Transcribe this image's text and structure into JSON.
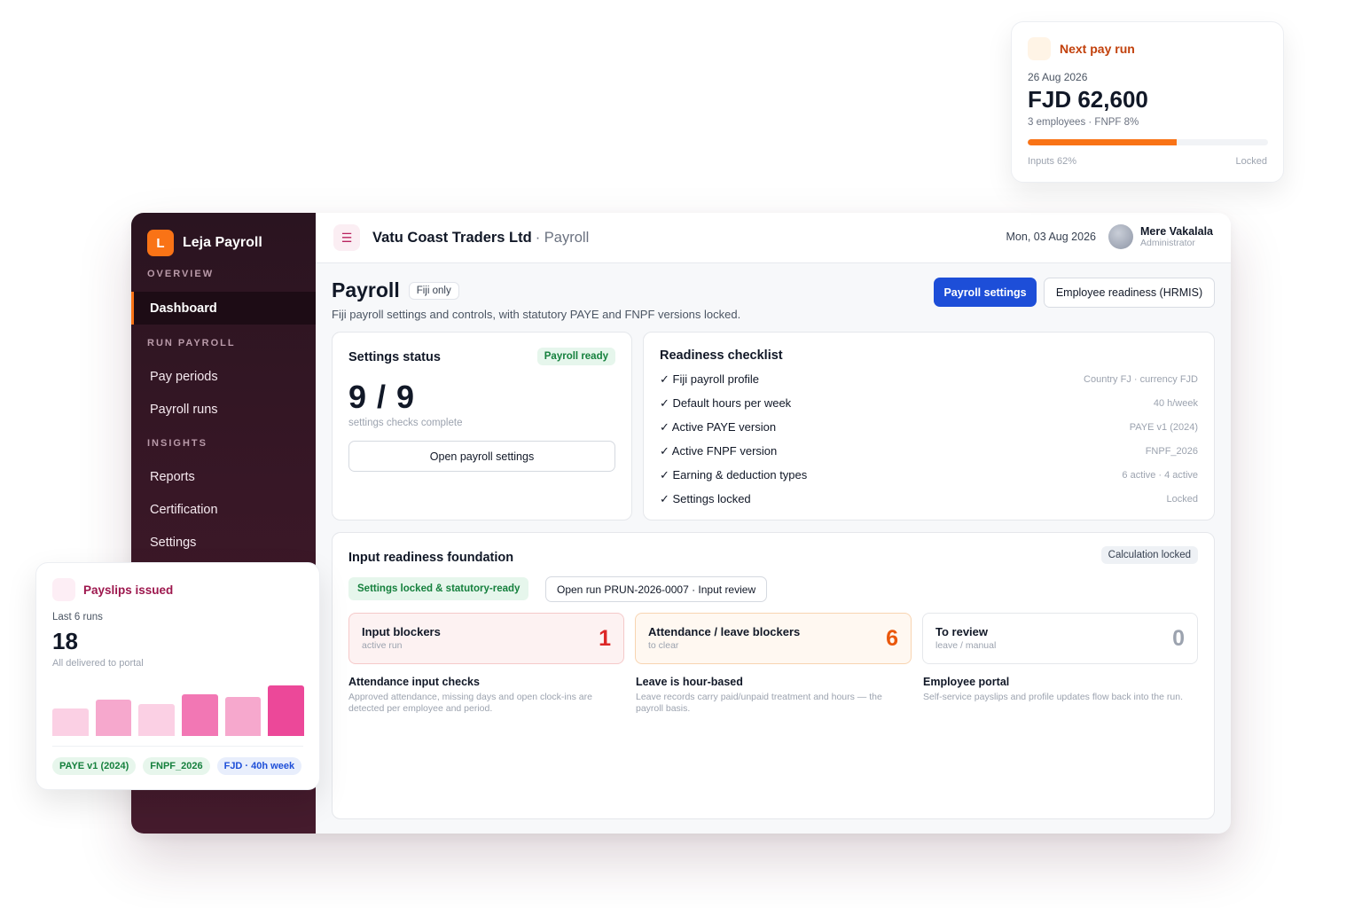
{
  "sidebar": {
    "brand_initial": "L",
    "brand_name": "Leja Payroll",
    "sections": [
      "OVERVIEW",
      "RUN PAYROLL",
      "INSIGHTS"
    ],
    "items": [
      {
        "label": "Dashboard",
        "active": true
      },
      {
        "label": "Pay periods"
      },
      {
        "label": "Payroll runs"
      },
      {
        "label": "Reports"
      },
      {
        "label": "Certification"
      },
      {
        "label": "Settings"
      }
    ]
  },
  "topbar": {
    "menu_icon": "hamburger-icon",
    "company": "Vatu Coast Traders Ltd",
    "module": "· Payroll",
    "date": "Mon, 03 Aug 2026",
    "user_name": "Mere Vakalala",
    "user_role": "Administrator"
  },
  "page": {
    "title": "Payroll",
    "tag": "Fiji only",
    "description": "Fiji payroll settings and controls, with statutory PAYE and FNPF versions locked.",
    "primary_button": "Payroll settings",
    "secondary_button": "Employee readiness (HRMIS)"
  },
  "settings_status": {
    "title": "Settings status",
    "badge": "Payroll ready",
    "count": "9 / 9",
    "caption": "settings checks complete",
    "button": "Open payroll settings"
  },
  "checklist": {
    "title": "Readiness checklist",
    "items": [
      {
        "label": "✓ Fiji payroll profile",
        "value": "Country FJ · currency FJD"
      },
      {
        "label": "✓ Default hours per week",
        "value": "40 h/week"
      },
      {
        "label": "✓ Active PAYE version",
        "value": "PAYE v1 (2024)"
      },
      {
        "label": "✓ Active FNPF version",
        "value": "FNPF_2026"
      },
      {
        "label": "✓ Earning & deduction types",
        "value": "6 active · 4 active"
      },
      {
        "label": "✓ Settings locked",
        "value": "Locked"
      }
    ]
  },
  "input_readiness": {
    "title": "Input readiness foundation",
    "badge": "Calculation locked",
    "status_pill": "Settings locked & statutory-ready",
    "run_button": "Open run PRUN-2026-0007 · Input review",
    "blockers": [
      {
        "title": "Input blockers",
        "sub": "active run",
        "count": "1",
        "color": "#dc2626",
        "bg": "#fdf2f2",
        "border": "#f5c9c9"
      },
      {
        "title": "Attendance / leave blockers",
        "sub": "to clear",
        "count": "6",
        "color": "#ea580c",
        "bg": "#fff8f1",
        "border": "#f8d4b1"
      },
      {
        "title": "To review",
        "sub": "leave / manual",
        "count": "0",
        "color": "#9ca3af",
        "bg": "#ffffff",
        "border": "#e5e7eb"
      }
    ],
    "info": [
      {
        "title": "Attendance input checks",
        "body": "Approved attendance, missing days and open clock-ins are detected per employee and period."
      },
      {
        "title": "Leave is hour-based",
        "body": "Leave records carry paid/unpaid treatment and hours — the payroll basis."
      },
      {
        "title": "Employee portal",
        "body": "Self-service payslips and profile updates flow back into the run."
      }
    ]
  },
  "next_pay_run": {
    "title": "Next pay run",
    "date": "26 Aug 2026",
    "amount": "FJD 62,600",
    "meta": "3 employees · FNPF 8%",
    "progress": 0.62,
    "progress_label": "Inputs 62%",
    "status": "Locked",
    "accent": "#f97316"
  },
  "payslips": {
    "title": "Payslips issued",
    "period": "Last 6 runs",
    "count": "18",
    "caption": "All delivered to portal",
    "bar_values": [
      0.54,
      0.72,
      0.63,
      0.82,
      0.77,
      1.0
    ],
    "bar_colors": [
      "#fbd0e4",
      "#f6a8cd",
      "#fbd0e4",
      "#f277b4",
      "#f6a8cd",
      "#ec4899"
    ],
    "chips": [
      {
        "label": "PAYE v1 (2024)",
        "color": "#15803d",
        "bg": "#e7f6ec"
      },
      {
        "label": "FNPF_2026",
        "color": "#15803d",
        "bg": "#e7f6ec"
      },
      {
        "label": "FJD · 40h week",
        "color": "#1d4ed8",
        "bg": "#e8eefc"
      }
    ]
  }
}
